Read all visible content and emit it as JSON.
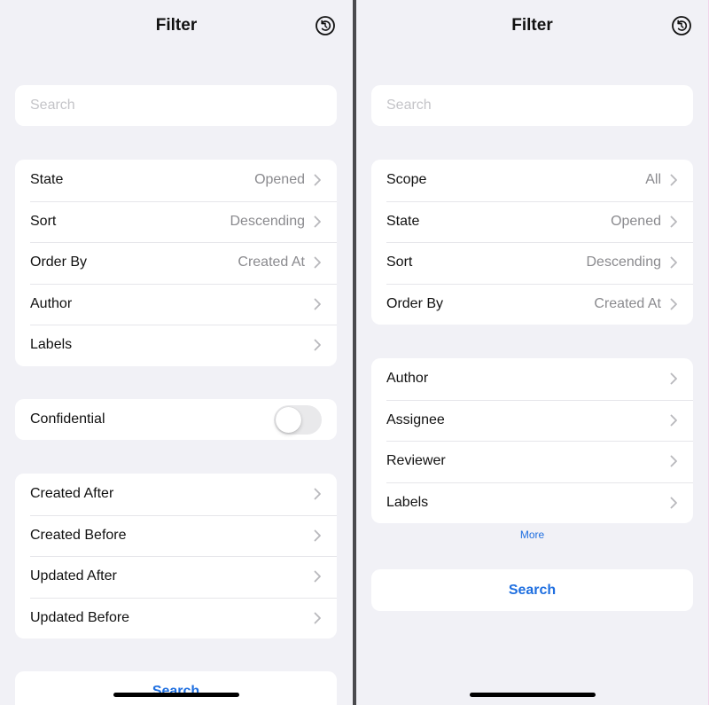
{
  "left": {
    "title": "Filter",
    "search_placeholder": "Search",
    "group1": [
      {
        "label": "State",
        "value": "Opened"
      },
      {
        "label": "Sort",
        "value": "Descending"
      },
      {
        "label": "Order By",
        "value": "Created At"
      },
      {
        "label": "Author",
        "value": ""
      },
      {
        "label": "Labels",
        "value": ""
      }
    ],
    "confidential": {
      "label": "Confidential",
      "enabled": false
    },
    "group3": [
      {
        "label": "Created After"
      },
      {
        "label": "Created Before"
      },
      {
        "label": "Updated After"
      },
      {
        "label": "Updated Before"
      }
    ],
    "search_button": "Search"
  },
  "right": {
    "title": "Filter",
    "search_placeholder": "Search",
    "group1": [
      {
        "label": "Scope",
        "value": "All"
      },
      {
        "label": "State",
        "value": "Opened"
      },
      {
        "label": "Sort",
        "value": "Descending"
      },
      {
        "label": "Order By",
        "value": "Created At"
      }
    ],
    "group2": [
      {
        "label": "Author"
      },
      {
        "label": "Assignee"
      },
      {
        "label": "Reviewer"
      },
      {
        "label": "Labels"
      }
    ],
    "more_link": "More",
    "search_button": "Search"
  },
  "icons": {
    "reset": "reset-icon",
    "chevron": "chevron-right-icon"
  },
  "colors": {
    "background": "#f1f1f6",
    "accent": "#1f6fe0",
    "secondary_text": "#8a8a8e"
  }
}
